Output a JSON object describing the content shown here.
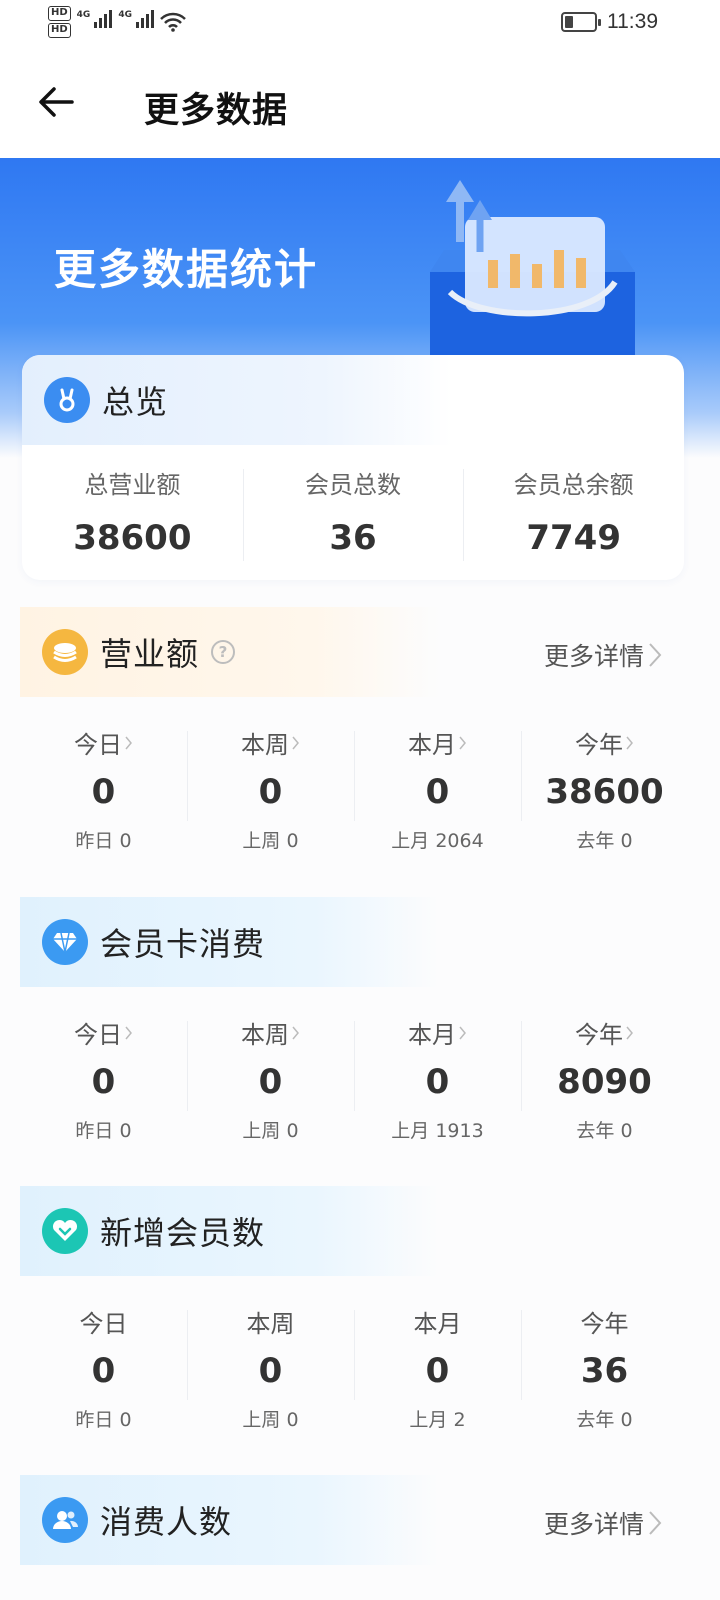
{
  "status": {
    "hd1": "HD",
    "hd2": "HD",
    "net1": "4G",
    "net2": "4G",
    "battery_level": 0.3,
    "time": "11:39"
  },
  "header": {
    "title": "更多数据",
    "back_icon": "arrow-left-icon"
  },
  "banner": {
    "title": "更多数据统计"
  },
  "overview": {
    "title": "总览",
    "icon": "rabbit-badge-icon",
    "stats": [
      {
        "label": "总营业额",
        "value": "38600"
      },
      {
        "label": "会员总数",
        "value": "36"
      },
      {
        "label": "会员总余额",
        "value": "7749"
      }
    ]
  },
  "revenue": {
    "title": "营业额",
    "icon": "coin-stack-icon",
    "more": "更多详情",
    "cells": [
      {
        "label": "今日",
        "value": "0",
        "sub": "昨日 0"
      },
      {
        "label": "本周",
        "value": "0",
        "sub": "上周 0"
      },
      {
        "label": "本月",
        "value": "0",
        "sub": "上月 2064"
      },
      {
        "label": "今年",
        "value": "38600",
        "sub": "去年 0"
      }
    ]
  },
  "card_consumption": {
    "title": "会员卡消费",
    "icon": "diamond-icon",
    "cells": [
      {
        "label": "今日",
        "value": "0",
        "sub": "昨日 0"
      },
      {
        "label": "本周",
        "value": "0",
        "sub": "上周 0"
      },
      {
        "label": "本月",
        "value": "0",
        "sub": "上月 1913"
      },
      {
        "label": "今年",
        "value": "8090",
        "sub": "去年 0"
      }
    ]
  },
  "new_members": {
    "title": "新增会员数",
    "icon": "heart-chevron-icon",
    "cells": [
      {
        "label": "今日",
        "value": "0",
        "sub": "昨日 0"
      },
      {
        "label": "本周",
        "value": "0",
        "sub": "上周 0"
      },
      {
        "label": "本月",
        "value": "0",
        "sub": "上月 2"
      },
      {
        "label": "今年",
        "value": "36",
        "sub": "去年 0"
      }
    ]
  },
  "consumers": {
    "title": "消费人数",
    "icon": "users-icon",
    "more": "更多详情"
  },
  "colors": {
    "primary": "#2f78f2",
    "orange": "#f5b740",
    "cyan": "#1cc6b4",
    "blue_icon": "#3b9af2"
  }
}
